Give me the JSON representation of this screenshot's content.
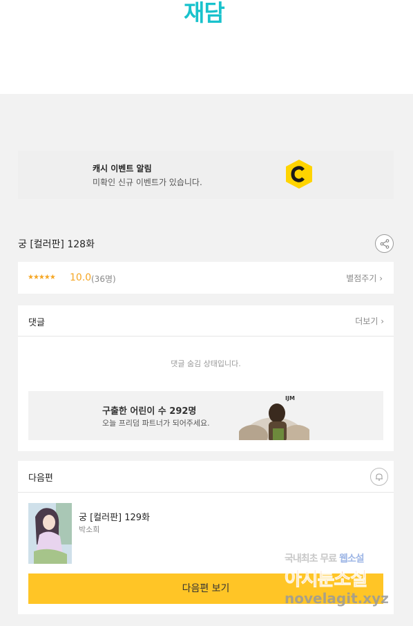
{
  "header": {
    "logo": "재담"
  },
  "cash_banner": {
    "title": "캐시 이벤트 알림",
    "subtitle": "미확인 신규 이벤트가 있습니다.",
    "icon": "coin-c-icon",
    "icon_color": "#ffd400"
  },
  "episode": {
    "title": "궁 [컬러판] 128화",
    "share_icon": "share-icon"
  },
  "rating": {
    "stars": "★★★★★",
    "score": "10.0",
    "count": "(36명)",
    "rate_label": "별점주기 ›"
  },
  "comments": {
    "label": "댓글",
    "more_label": "더보기 ›",
    "hidden_message": "댓글 숨김 상태입니다."
  },
  "ad": {
    "title": "구출한 어린이 수 292명",
    "subtitle": "오늘 프리덤 파트너가 되어주세요.",
    "logo": "IJM"
  },
  "next_episode": {
    "label": "다음편",
    "bell_icon": "bell-icon",
    "title": "궁 [컬러판] 129화",
    "author": "박소희",
    "button_label": "다음편 보기",
    "button_color": "#ffc526"
  },
  "watermark": {
    "line1_a": "국내최초 무료",
    "line1_b": "웹소설",
    "line2": "아지툰소설",
    "line3": "novelagit.xyz"
  },
  "colors": {
    "accent": "#19c2cc",
    "star": "#f5a623"
  }
}
